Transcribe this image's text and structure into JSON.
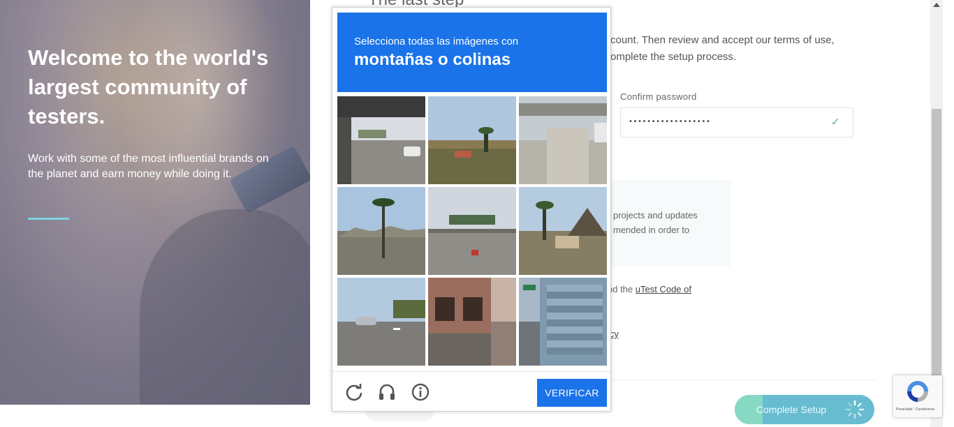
{
  "hero": {
    "title": "Welcome to the world's largest community of testers.",
    "subtitle": "Work with some of the most influential brands on the planet and earn money while doing it."
  },
  "form": {
    "heading_partial": "The last step",
    "intro_line1": "count. Then review and accept our terms of use,",
    "intro_line2": "omplete the setup process.",
    "confirm_password_label": "Confirm password",
    "confirm_password_value": "••••••••••••••••••",
    "info_line1": "projects and updates",
    "info_line2": "mended in order to",
    "conduct_prefix": "nd the ",
    "conduct_link": "uTest Code of",
    "policy_partial": "icy",
    "complete_button": "Complete Setup"
  },
  "captcha": {
    "instruction": "Selecciona todas las imágenes con",
    "target": "montañas o colinas",
    "verify_button": "VERIFICAR",
    "tiles": [
      "tile-1",
      "tile-2",
      "tile-3",
      "tile-4",
      "tile-5",
      "tile-6",
      "tile-7",
      "tile-8",
      "tile-9"
    ]
  },
  "recaptcha_badge": {
    "text": "Privacidad - Condiciones"
  },
  "icons": {
    "reload": "reload-icon",
    "audio": "headphones-icon",
    "info": "info-icon",
    "check": "check-icon"
  },
  "colors": {
    "captcha_blue": "#1a73e8",
    "accent_line": "#7fd3e3",
    "button_teal": "#67bcd0"
  }
}
